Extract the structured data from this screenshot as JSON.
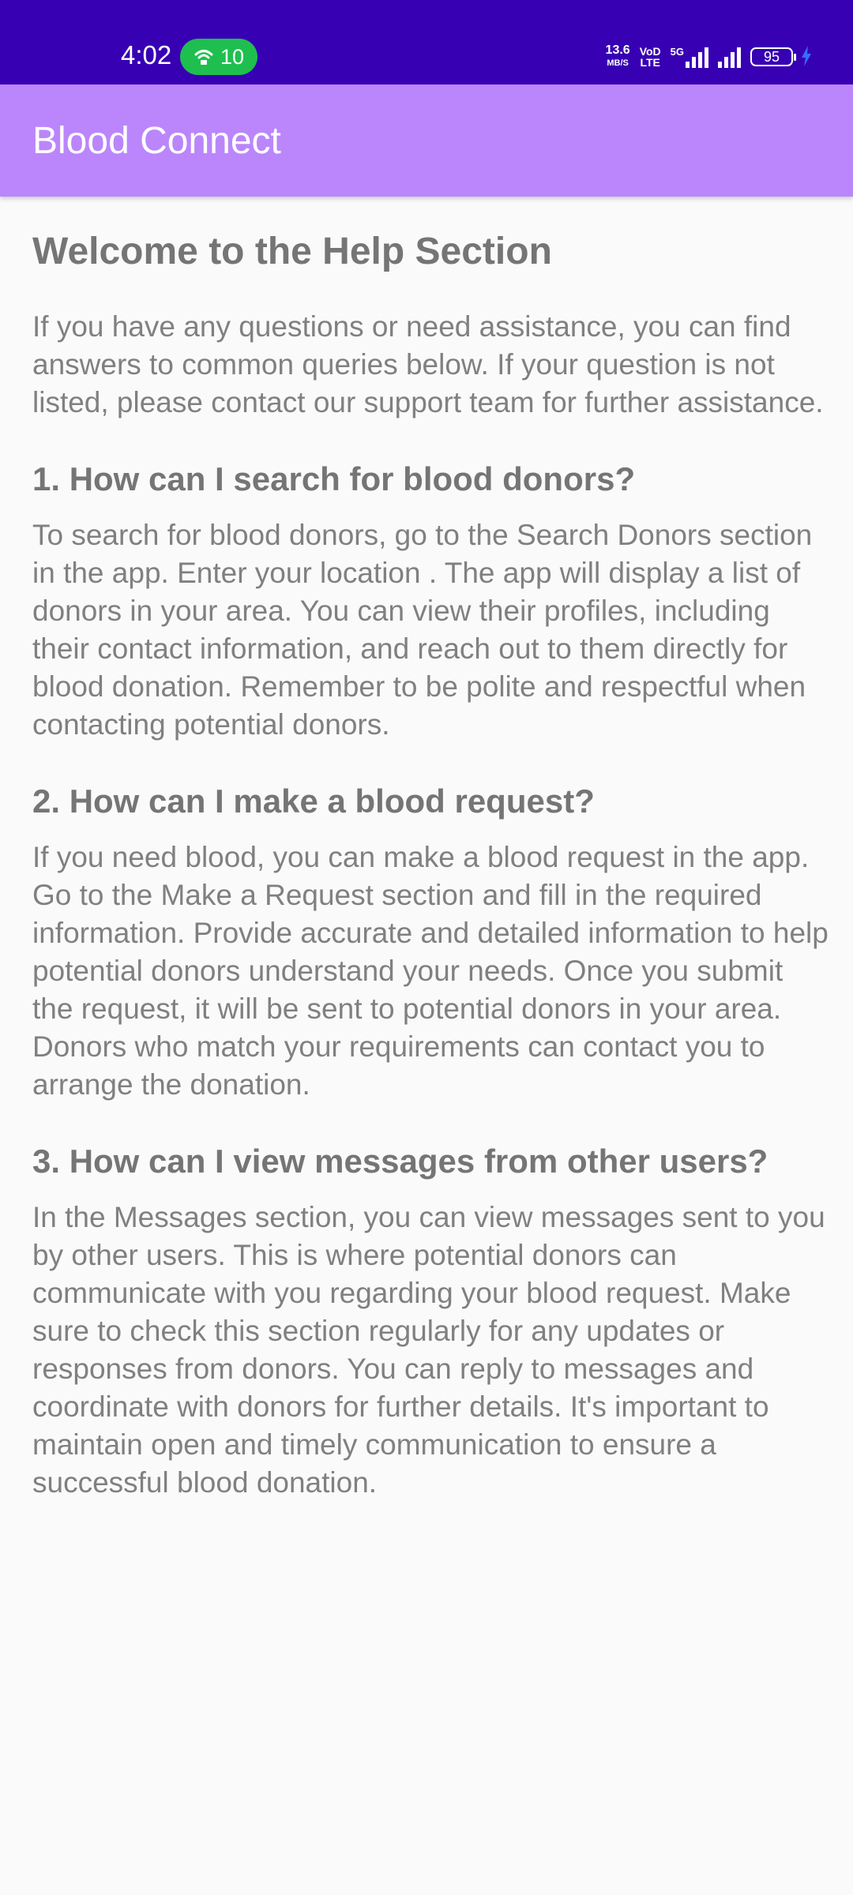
{
  "status_bar": {
    "time": "4:02",
    "hotspot_count": "10",
    "speed_value": "13.6",
    "speed_unit": "MB/S",
    "volte_top": "VoD",
    "volte_bottom": "LTE",
    "network_type": "5G",
    "battery_level": "95",
    "bar_color": "#3700b3",
    "hotspot_color": "#1fbf4f"
  },
  "app_bar": {
    "title": "Blood Connect",
    "color": "#bb86fc"
  },
  "help": {
    "heading": "Welcome to the Help Section",
    "intro": "If you have any questions or need assistance, you can find answers to common queries below. If your question is not listed, please contact our support team for further assistance.",
    "faqs": [
      {
        "question": "1. How can I search for blood donors?",
        "answer": "To search for blood donors, go to the Search Donors section in the app. Enter your location . The app will display a list of  donors in your area. You can view their profiles, including their contact information, and reach out to them directly for blood donation. Remember to be polite and respectful when contacting potential donors."
      },
      {
        "question": "2. How can I make a blood request?",
        "answer": "If you need blood, you can make a blood request in the app. Go to the Make a Request section and fill in the required information. Provide accurate and detailed information to help potential donors understand your needs. Once you submit the request, it will be sent to potential donors in your area. Donors who match your requirements can contact you to arrange the donation."
      },
      {
        "question": "3. How can I view messages from other users?",
        "answer": "In the Messages section, you can view messages sent to you by other users. This is where potential donors can communicate with you regarding your blood request. Make sure to check this section regularly for any updates or responses from donors. You can reply to messages and coordinate with donors for further details. It's important to maintain open and timely communication to ensure a successful blood donation."
      }
    ]
  }
}
